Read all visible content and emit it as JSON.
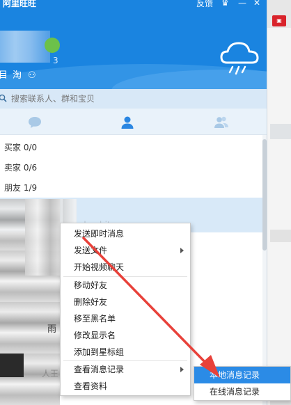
{
  "window": {
    "title": "阿里旺旺",
    "feedback_label": "反馈",
    "accent_color": "#1a84e0",
    "profile_number_fragment": "3"
  },
  "header_icons": [
    "menu-icon",
    "taobao-icon",
    "bag-icon"
  ],
  "header_icon_glyphs": [
    "目",
    "淘",
    "⚇"
  ],
  "window_controls": [
    "skin-icon",
    "minimize-icon",
    "close-icon"
  ],
  "window_control_glyphs": [
    "♛",
    "—",
    "✕"
  ],
  "search": {
    "placeholder": "搜索联系人、群和宝贝"
  },
  "tabs": [
    "chat-tab",
    "contacts-tab",
    "groups-tab"
  ],
  "groups": [
    {
      "name": "买家",
      "count": "0/0"
    },
    {
      "name": "卖家",
      "count": "0/6"
    },
    {
      "name": "朋友",
      "count": "1/9"
    }
  ],
  "fragments": {
    "rain": "雨",
    "person": "人王",
    "faint_text": "wchanhitu"
  },
  "context_menu": {
    "items": [
      {
        "label": "发送即时消息",
        "submenu": false
      },
      {
        "label": "发送文件",
        "submenu": true
      },
      {
        "label": "开始视频聊天",
        "submenu": false
      },
      {
        "label": "移动好友",
        "submenu": false
      },
      {
        "label": "删除好友",
        "submenu": false
      },
      {
        "label": "移至黑名单",
        "submenu": false
      },
      {
        "label": "修改显示名",
        "submenu": false
      },
      {
        "label": "添加到星标组",
        "submenu": false
      },
      {
        "label": "查看消息记录",
        "submenu": true
      },
      {
        "label": "查看资料",
        "submenu": false
      }
    ]
  },
  "submenu": {
    "items": [
      {
        "label": "本地消息记录",
        "highlighted": true
      },
      {
        "label": "在线消息记录",
        "highlighted": false
      }
    ],
    "highlight_color": "#2b8be6"
  },
  "annotation": {
    "arrow_color": "#e8413a"
  }
}
